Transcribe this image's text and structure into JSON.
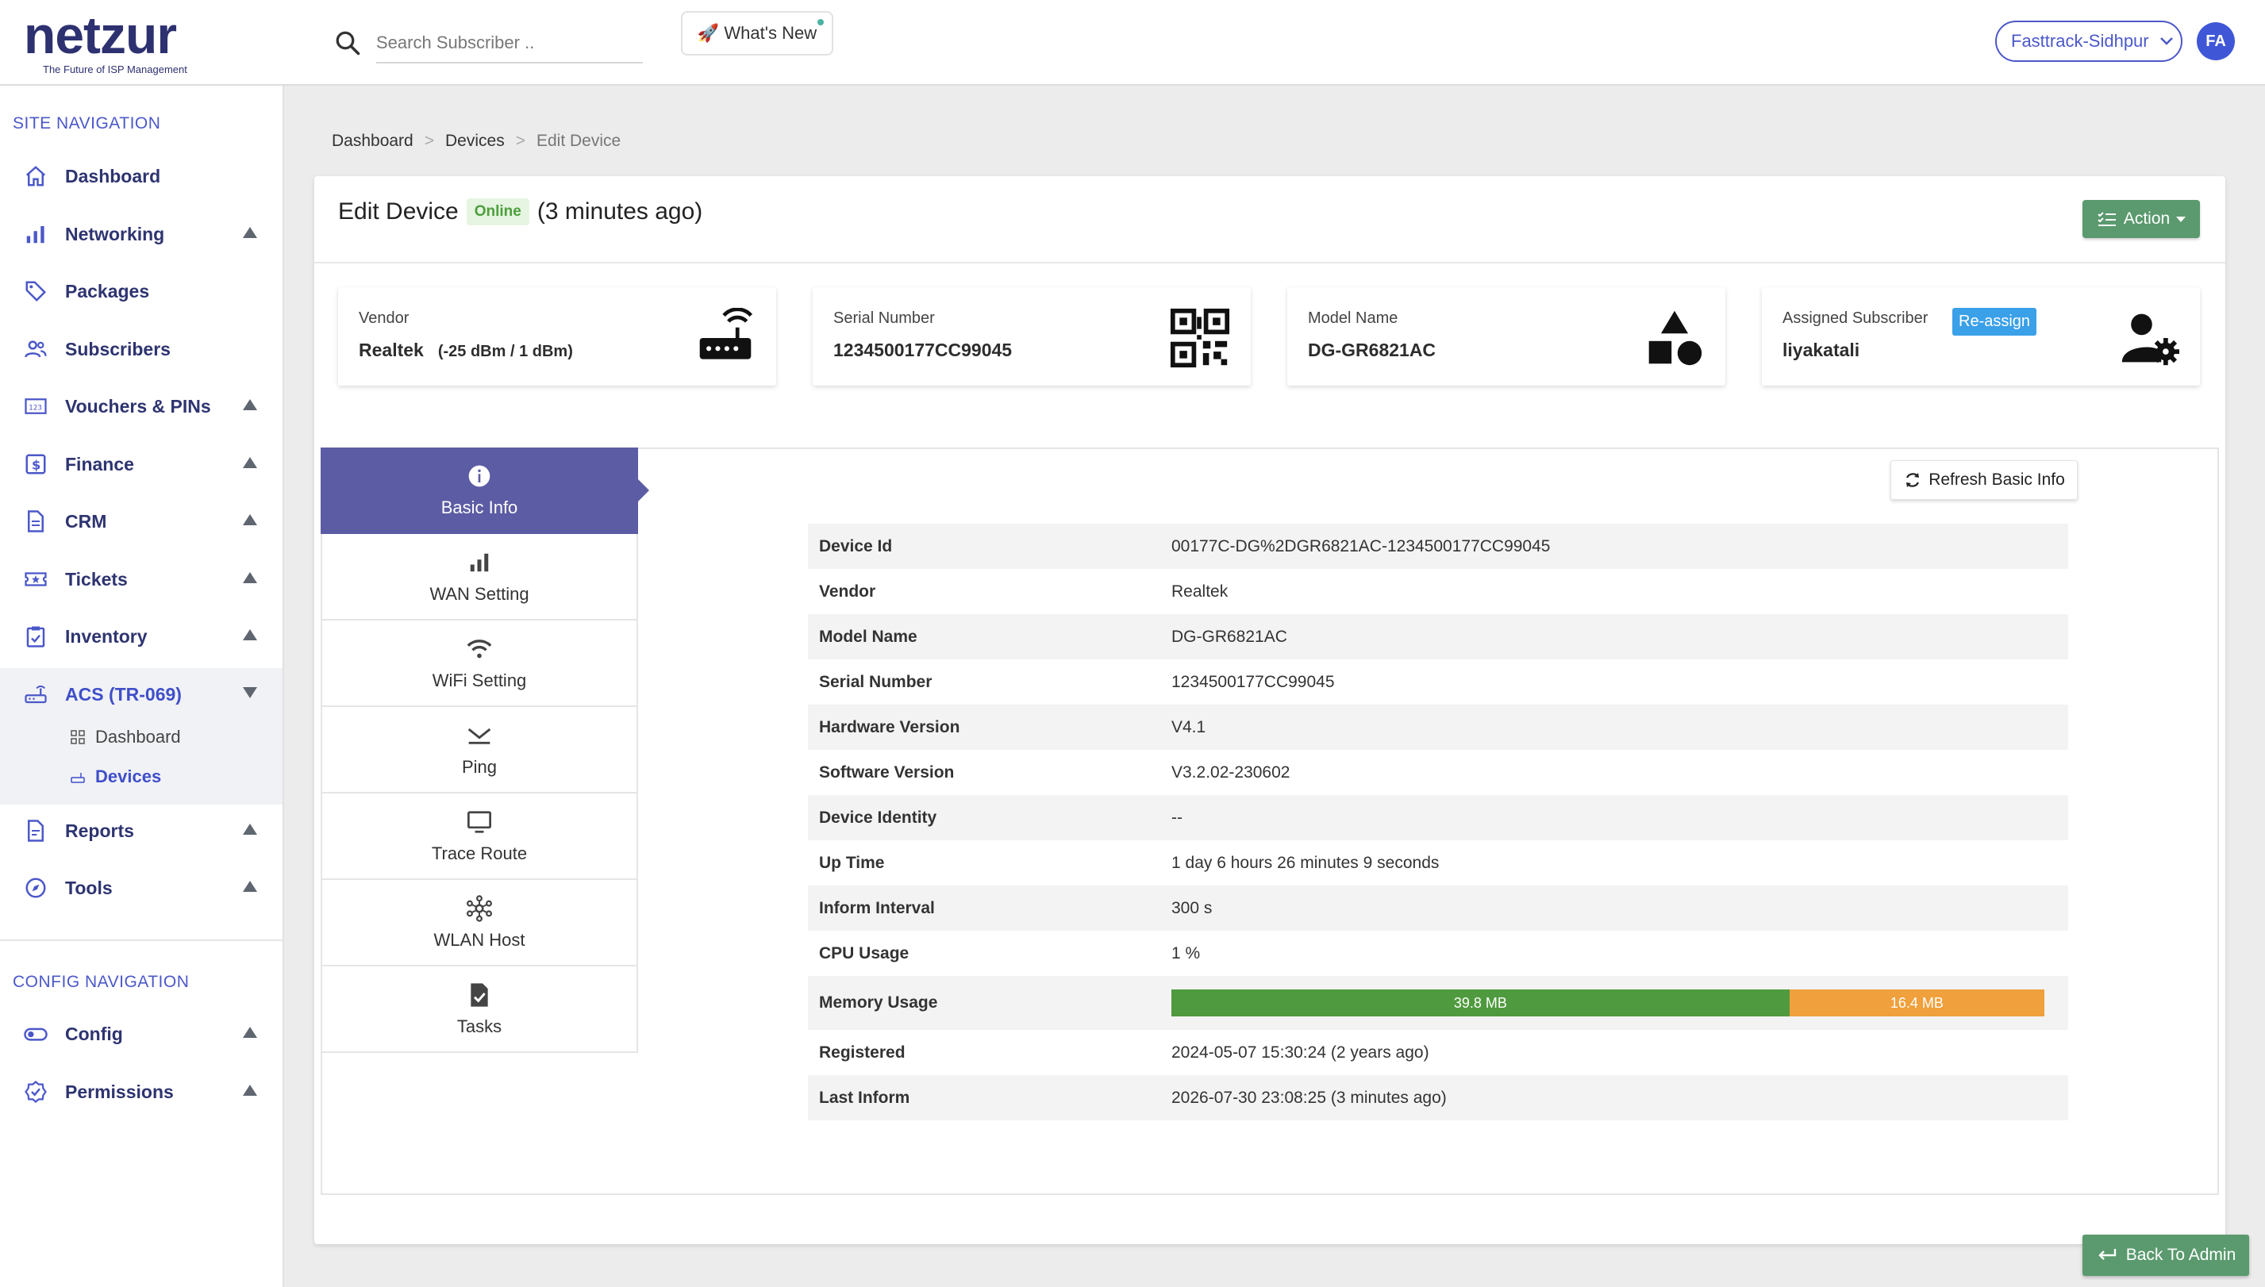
{
  "header": {
    "logo_text": "netzur",
    "logo_tagline": "The Future of ISP Management",
    "search_placeholder": "Search Subscriber ..",
    "whats_new": "🚀 What's New",
    "site_selector": "Fasttrack-Sidhpur",
    "avatar_initials": "FA"
  },
  "sidebar": {
    "site_nav_title": "SITE NAVIGATION",
    "items": [
      {
        "label": "Dashboard",
        "icon": "home-icon"
      },
      {
        "label": "Networking",
        "icon": "bar-chart-icon"
      },
      {
        "label": "Packages",
        "icon": "tag-icon"
      },
      {
        "label": "Subscribers",
        "icon": "users-icon"
      },
      {
        "label": "Vouchers & PINs",
        "icon": "voucher-icon"
      },
      {
        "label": "Finance",
        "icon": "dollar-icon"
      },
      {
        "label": "CRM",
        "icon": "document-icon"
      },
      {
        "label": "Tickets",
        "icon": "ticket-icon"
      },
      {
        "label": "Inventory",
        "icon": "clipboard-icon"
      },
      {
        "label": "ACS (TR-069)",
        "icon": "router-icon"
      },
      {
        "label": "Reports",
        "icon": "report-icon"
      },
      {
        "label": "Tools",
        "icon": "compass-icon"
      }
    ],
    "acs_sub": [
      {
        "label": "Dashboard",
        "icon": "grid-icon"
      },
      {
        "label": "Devices",
        "icon": "device-icon"
      }
    ],
    "config_nav_title": "CONFIG NAVIGATION",
    "config_items": [
      {
        "label": "Config",
        "icon": "toggle-icon"
      },
      {
        "label": "Permissions",
        "icon": "badge-check-icon"
      }
    ]
  },
  "breadcrumb": {
    "items": [
      "Dashboard",
      "Devices"
    ],
    "current": "Edit Device"
  },
  "page": {
    "title": "Edit Device",
    "status": "Online",
    "status_suffix": "(3 minutes ago)",
    "action_label": "Action"
  },
  "summary": {
    "vendor": {
      "label": "Vendor",
      "value": "Realtek",
      "signal": "(-25 dBm / 1 dBm)"
    },
    "serial": {
      "label": "Serial Number",
      "value": "1234500177CC99045"
    },
    "model": {
      "label": "Model Name",
      "value": "DG-GR6821AC"
    },
    "subscriber": {
      "label": "Assigned Subscriber",
      "value": "liyakatali",
      "reassign": "Re-assign"
    }
  },
  "tabs": [
    {
      "label": "Basic Info",
      "icon": "info-icon"
    },
    {
      "label": "WAN Setting",
      "icon": "signal-bars-icon"
    },
    {
      "label": "WiFi Setting",
      "icon": "wifi-icon"
    },
    {
      "label": "Ping",
      "icon": "ping-icon"
    },
    {
      "label": "Trace Route",
      "icon": "monitor-icon"
    },
    {
      "label": "WLAN Host",
      "icon": "network-hub-icon"
    },
    {
      "label": "Tasks",
      "icon": "task-check-icon"
    }
  ],
  "refresh_label": "Refresh Basic Info",
  "basic_info": [
    {
      "key": "Device Id",
      "value": "00177C-DG%2DGR6821AC-1234500177CC99045"
    },
    {
      "key": "Vendor",
      "value": "Realtek"
    },
    {
      "key": "Model Name",
      "value": "DG-GR6821AC"
    },
    {
      "key": "Serial Number",
      "value": "1234500177CC99045"
    },
    {
      "key": "Hardware Version",
      "value": "V4.1"
    },
    {
      "key": "Software Version",
      "value": "V3.2.02-230602"
    },
    {
      "key": "Device Identity",
      "value": "--"
    },
    {
      "key": "Up Time",
      "value": "1 day 6 hours 26 minutes 9 seconds"
    },
    {
      "key": "Inform Interval",
      "value": "300 s"
    },
    {
      "key": "CPU Usage",
      "value": "1 %"
    },
    {
      "key": "Memory Usage",
      "value": ""
    },
    {
      "key": "Registered",
      "value": "2024-05-07 15:30:24 (2 years ago)"
    },
    {
      "key": "Last Inform",
      "value": "2026-07-30 23:08:25 (3 minutes ago)"
    }
  ],
  "memory": {
    "used": "39.8 MB",
    "free": "16.4 MB",
    "used_fraction": 0.708
  },
  "colors": {
    "accent": "#4b58c9",
    "nav_text": "#2e3470",
    "tab_active": "#5c5ca4",
    "green": "#5a9a6e",
    "mem_used": "#4f9a3e",
    "mem_free": "#f0a03c"
  },
  "back_to_admin": "Back To Admin"
}
